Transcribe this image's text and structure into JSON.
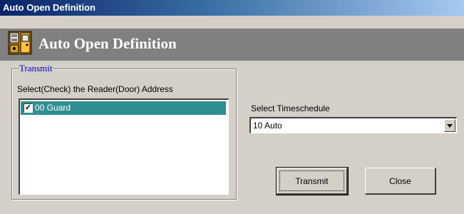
{
  "window": {
    "title": "Auto Open Definition"
  },
  "header": {
    "title": "Auto Open Definition",
    "icon": "door-panel-icon"
  },
  "transmit_group": {
    "legend": "Transmit",
    "instruction": "Select(Check) the Reader(Door) Address",
    "items": [
      {
        "label": "00 Guard",
        "checked": true,
        "selected": true
      }
    ]
  },
  "timeschedule": {
    "label": "Select Timeschedule",
    "value": "10 Auto"
  },
  "buttons": {
    "transmit": "Transmit",
    "close": "Close"
  },
  "colors": {
    "selection": "#2f8f8f",
    "legend": "#0000c0",
    "header_bg": "#808080"
  }
}
